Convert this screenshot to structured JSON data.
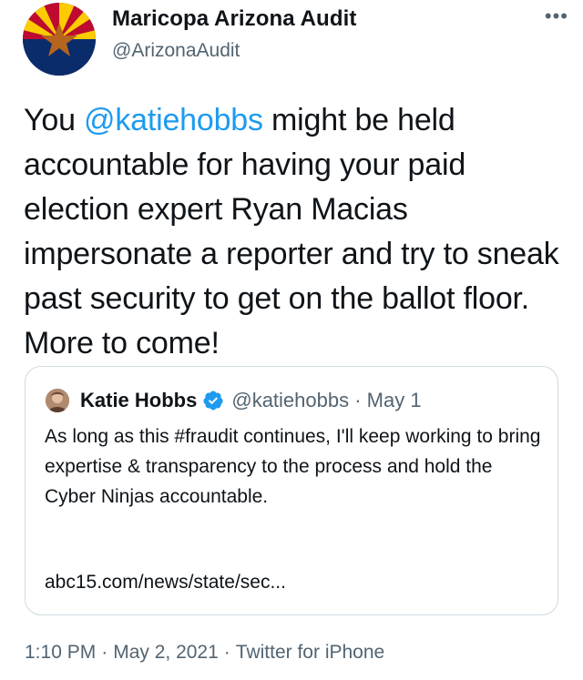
{
  "tweet": {
    "author": {
      "display_name": "Maricopa Arizona Audit",
      "handle": "@ArizonaAudit",
      "avatar_icon": "arizona-flag-avatar"
    },
    "more_label": "•••",
    "text": {
      "prefix": "You ",
      "mention": "@katiehobbs",
      "body": " might be held accountable for having your paid election expert Ryan Macias impersonate a reporter and try to sneak past security to get on the ballot floor. More to come!"
    },
    "quote": {
      "display_name": "Katie Hobbs",
      "verified_icon": "verified-badge-icon",
      "handle_date": "@katiehobbs · May 1",
      "text": "As long as this #fraudit continues, I'll keep working to bring expertise & transparency to the process and hold the Cyber Ninjas accountable.",
      "link": "abc15.com/news/state/sec..."
    },
    "meta": {
      "time": "1:10 PM",
      "date": "May 2, 2021",
      "source": "Twitter for iPhone"
    }
  },
  "colors": {
    "link": "#1d9bf0",
    "secondary": "#536471",
    "border": "#cfd9de"
  }
}
